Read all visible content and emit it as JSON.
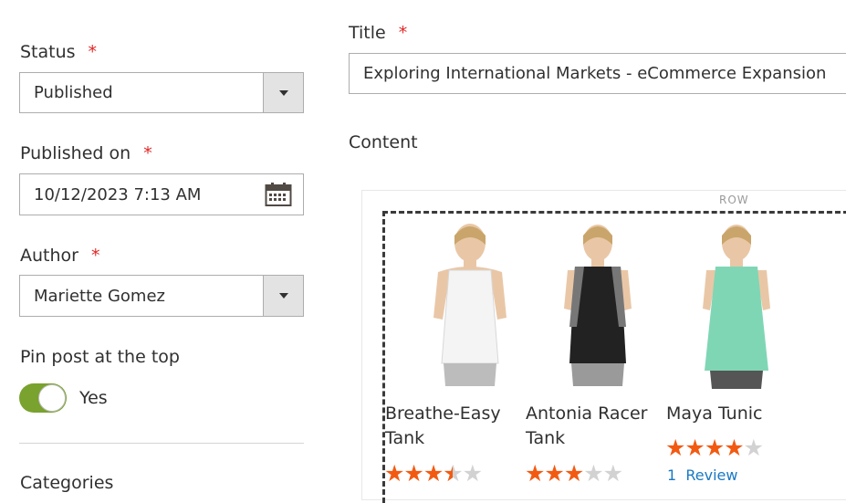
{
  "status": {
    "label": "Status",
    "required": "*",
    "value": "Published"
  },
  "published_on": {
    "label": "Published on",
    "required": "*",
    "value": "10/12/2023 7:13 AM"
  },
  "author": {
    "label": "Author",
    "required": "*",
    "value": "Mariette Gomez"
  },
  "pin_post": {
    "label": "Pin post at the top",
    "state_label": "Yes",
    "enabled": true
  },
  "categories": {
    "label": "Categories"
  },
  "title_field": {
    "label": "Title",
    "required": "*",
    "value": "Exploring International Markets - eCommerce Expansion"
  },
  "content": {
    "label": "Content",
    "row_tag": "ROW"
  },
  "products": [
    {
      "name": "Breathe-Easy Tank",
      "rating": 3.5,
      "shirt_color": "#f4f4f4"
    },
    {
      "name": "Antonia Racer Tank",
      "rating": 3,
      "shirt_color": "#222222"
    },
    {
      "name": "Maya Tunic",
      "rating": 4,
      "shirt_color": "#7fd6b5",
      "review_count": "1",
      "review_label": "Review"
    }
  ],
  "colors": {
    "star_on": "#f25a12",
    "star_off": "#d2d2d2",
    "toggle_on": "#79a22e",
    "required": "#e22626",
    "link": "#1979c3"
  }
}
